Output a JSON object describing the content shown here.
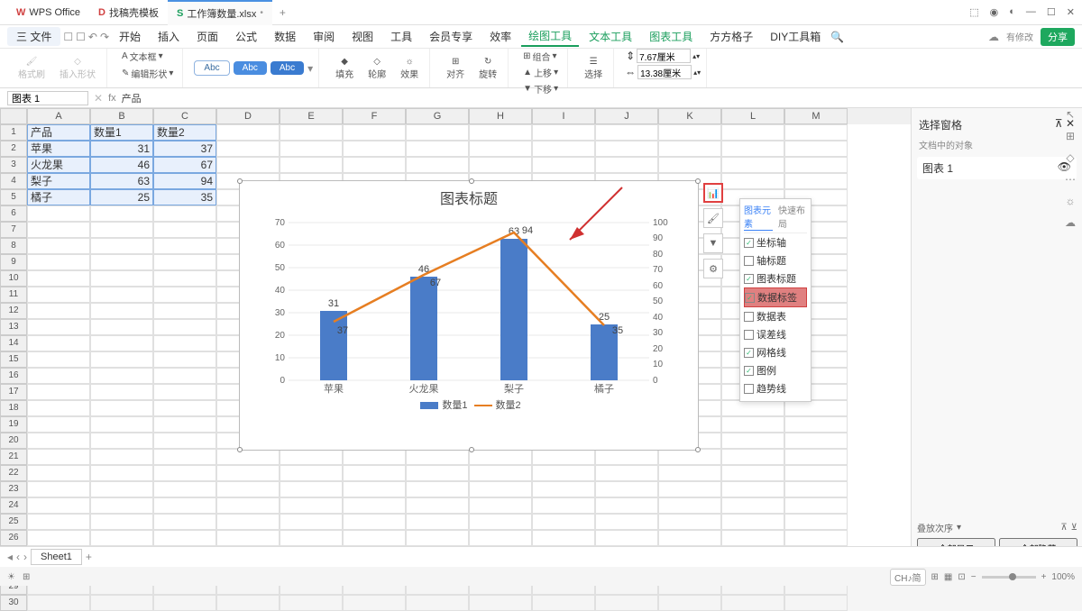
{
  "app": {
    "name": "WPS Office"
  },
  "tabs": [
    {
      "icon": "D",
      "label": "找稿壳模板"
    },
    {
      "icon": "S",
      "label": "工作簿数量.xlsx",
      "active": true
    }
  ],
  "menubar": {
    "file": "三 文件",
    "items": [
      "开始",
      "插入",
      "页面",
      "公式",
      "数据",
      "审阅",
      "视图",
      "工具",
      "会员专享",
      "效率"
    ],
    "green": [
      "绘图工具",
      "文本工具",
      "图表工具"
    ],
    "extra": [
      "方方格子",
      "DIY工具箱"
    ],
    "pending": "有修改",
    "share": "分享"
  },
  "ribbon": {
    "brush": "格式刷",
    "insert_shape": "插入形状",
    "textbox": "文本框",
    "edit_shape": "编辑形状",
    "abc": [
      "Abc",
      "Abc",
      "Abc"
    ],
    "fill": "填充",
    "outline": "轮廓",
    "effect": "效果",
    "align": "对齐",
    "rotate": "旋转",
    "group": "组合",
    "ungroup": "上移",
    "down": "下移",
    "select": "选择",
    "w": "7.67厘米",
    "h": "13.38厘米"
  },
  "namebox": "图表 1",
  "formula": "产品",
  "cols": [
    "A",
    "B",
    "C",
    "D",
    "E",
    "F",
    "G",
    "H",
    "I",
    "J",
    "K",
    "L",
    "M"
  ],
  "data_rows": [
    [
      "产品",
      "数量1",
      "数量2"
    ],
    [
      "苹果",
      "31",
      "37"
    ],
    [
      "火龙果",
      "46",
      "67"
    ],
    [
      "梨子",
      "63",
      "94"
    ],
    [
      "橘子",
      "25",
      "35"
    ]
  ],
  "chart_data": {
    "type": "bar+line",
    "title": "图表标题",
    "categories": [
      "苹果",
      "火龙果",
      "梨子",
      "橘子"
    ],
    "series": [
      {
        "name": "数量1",
        "type": "bar",
        "values": [
          31,
          46,
          63,
          25
        ],
        "axis": "left",
        "color": "#4a7cc8"
      },
      {
        "name": "数量2",
        "type": "line",
        "values": [
          37,
          67,
          94,
          35
        ],
        "axis": "right",
        "color": "#e67e22"
      }
    ],
    "y_left": {
      "min": 0,
      "max": 70,
      "step": 10
    },
    "y_right": {
      "min": 0,
      "max": 100,
      "step": 10
    },
    "legend": [
      "数量1",
      "数量2"
    ]
  },
  "popup": {
    "tabs": [
      "图表元素",
      "快速布局"
    ],
    "items": [
      {
        "label": "坐标轴",
        "checked": true
      },
      {
        "label": "轴标题",
        "checked": false
      },
      {
        "label": "图表标题",
        "checked": true
      },
      {
        "label": "数据标签",
        "checked": true,
        "highlight": true
      },
      {
        "label": "数据表",
        "checked": false
      },
      {
        "label": "误差线",
        "checked": false
      },
      {
        "label": "网格线",
        "checked": true
      },
      {
        "label": "图例",
        "checked": true
      },
      {
        "label": "趋势线",
        "checked": false
      }
    ]
  },
  "right_panel": {
    "title": "选择窗格",
    "sub": "文档中的对象",
    "item": "图表 1",
    "show_all": "全部显示",
    "hide_all": "全部隐藏",
    "stack": "叠放次序"
  },
  "sheet_tab": "Sheet1",
  "zoom": "100%",
  "ch_btn": "CH♪简"
}
